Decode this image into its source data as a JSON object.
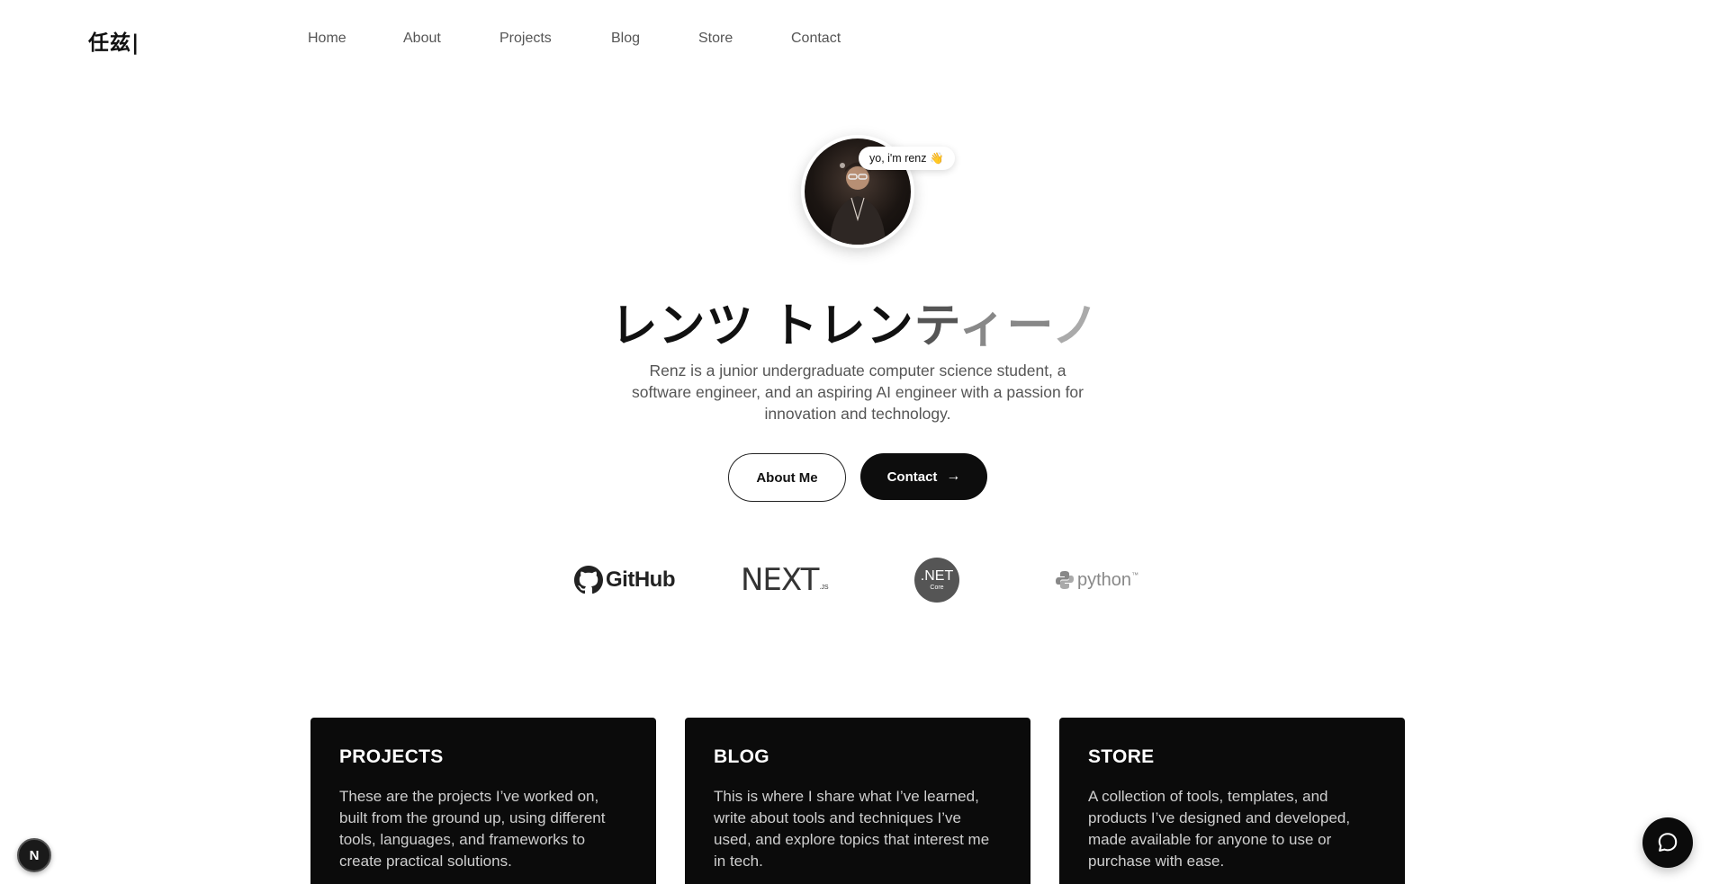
{
  "header": {
    "logo": "任兹|",
    "nav": [
      "Home",
      "About",
      "Projects",
      "Blog",
      "Store",
      "Contact"
    ]
  },
  "hero": {
    "greeting": "yo, i'm renz 👋",
    "title_dark": "レンツ トレン",
    "title_fade1": "テ",
    "title_fade2": "ィー",
    "title_fade3": "ノ",
    "description": "Renz is a junior undergraduate computer science student, a software engineer, and an aspiring AI engineer with a passion for innovation and technology.",
    "about_button": "About Me",
    "contact_button": "Contact",
    "avatar_icon": "person-photo-icon"
  },
  "tech_logos": {
    "github": "GitHub",
    "next": "NEXT",
    "next_sub": ".JS",
    "net": ".NET",
    "net_sub": "Core",
    "python": "python",
    "python_tm": "™"
  },
  "cards": [
    {
      "title": "PROJECTS",
      "body": "These are the projects I’ve worked on, built from the ground up, using different tools, languages, and frameworks to create practical solutions."
    },
    {
      "title": "BLOG",
      "body": "This is where I share what I’ve learned, write about tools and techniques I’ve used, and explore topics that interest me in tech."
    },
    {
      "title": "STORE",
      "body": "A collection of tools, templates, and products I’ve designed and developed, made available for anyone to use or purchase with ease."
    }
  ],
  "floating": {
    "badge_letter": "N",
    "chat_icon": "chat-bubble-icon"
  },
  "colors": {
    "background": "#ffffff",
    "text": "#111111",
    "muted": "#555555",
    "card_bg": "#0b0b0b",
    "button_dark": "#0d0d0d"
  }
}
